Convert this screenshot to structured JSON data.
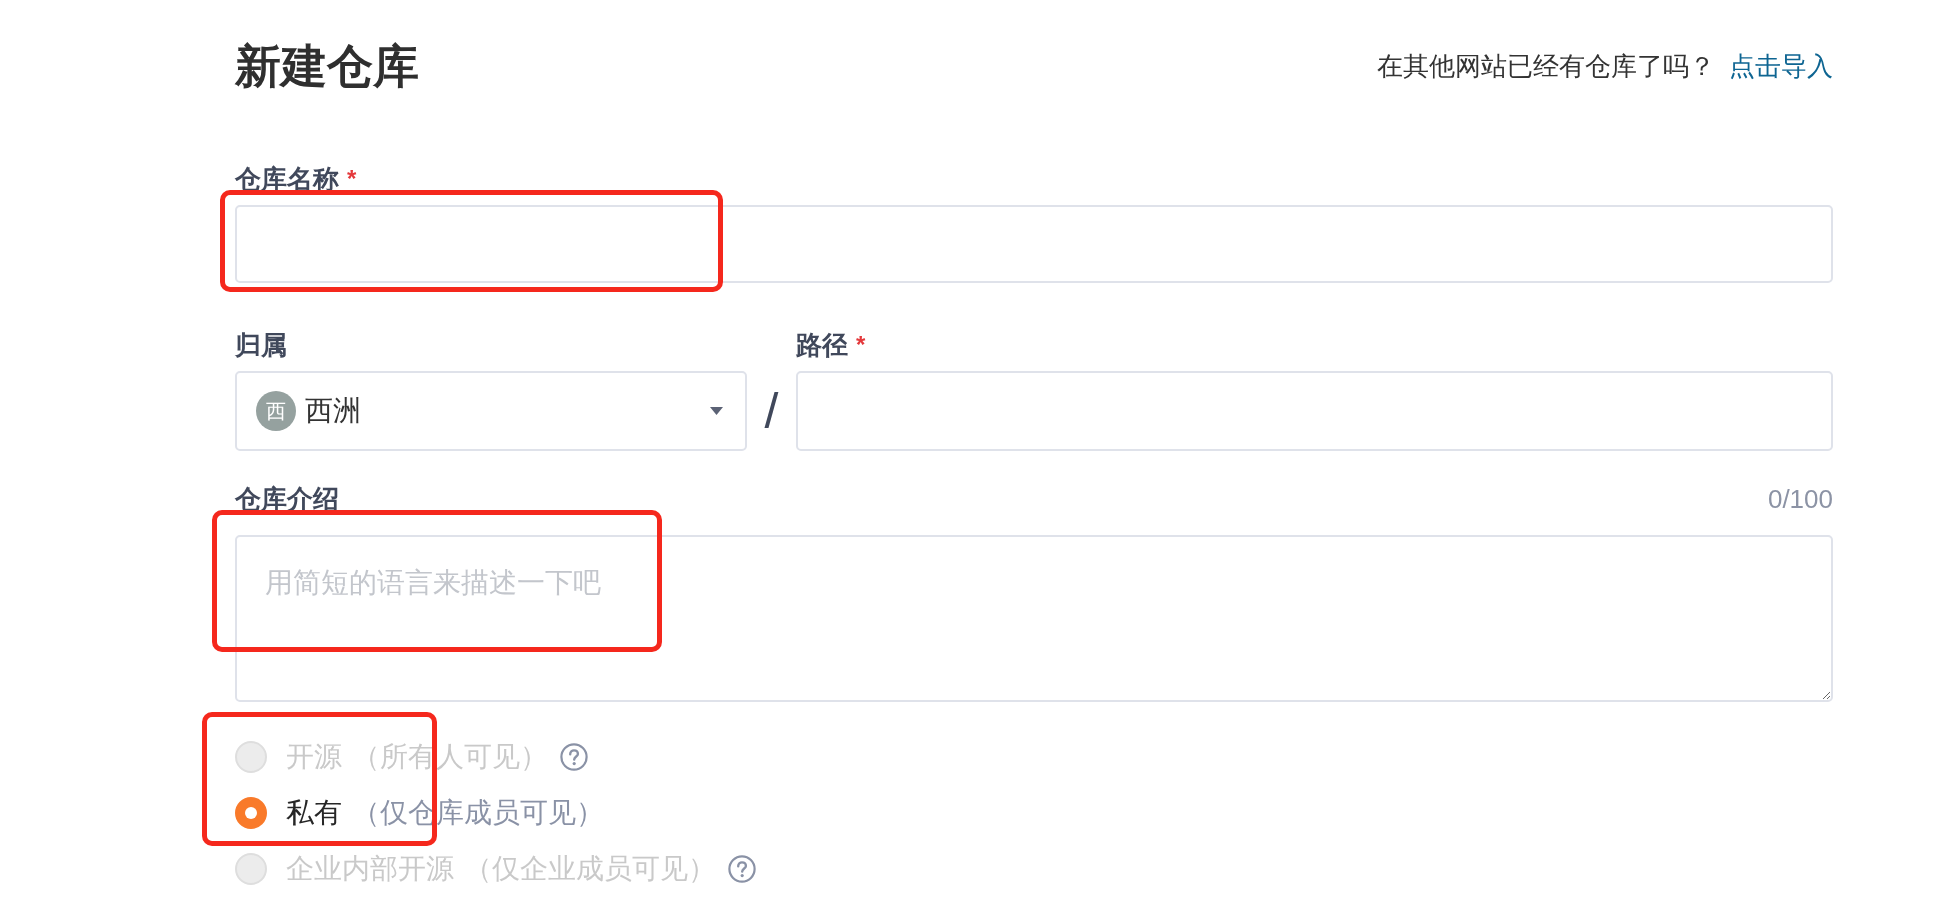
{
  "header": {
    "title": "新建仓库",
    "import_prompt": "在其他网站已经有仓库了吗？",
    "import_link": "点击导入"
  },
  "name_field": {
    "label": "仓库名称",
    "required_mark": "*",
    "highlighted": true
  },
  "owner_field": {
    "label": "归属",
    "avatar_letter": "西",
    "value": "西洲"
  },
  "path_separator": "/",
  "path_field": {
    "label": "路径",
    "required_mark": "*"
  },
  "description_field": {
    "label": "仓库介绍",
    "counter": "0/100",
    "placeholder": "用简短的语言来描述一下吧",
    "highlighted": true
  },
  "visibility": {
    "highlighted": true,
    "options": [
      {
        "label": "开源",
        "note": "（所有人可见）",
        "help_icon": true,
        "selected": false,
        "disabled": true
      },
      {
        "label": "私有",
        "note": "（仅仓库成员可见）",
        "help_icon": false,
        "selected": true,
        "disabled": false
      },
      {
        "label": "企业内部开源",
        "note": "（仅企业成员可见）",
        "help_icon": true,
        "selected": false,
        "disabled": true
      }
    ]
  }
}
